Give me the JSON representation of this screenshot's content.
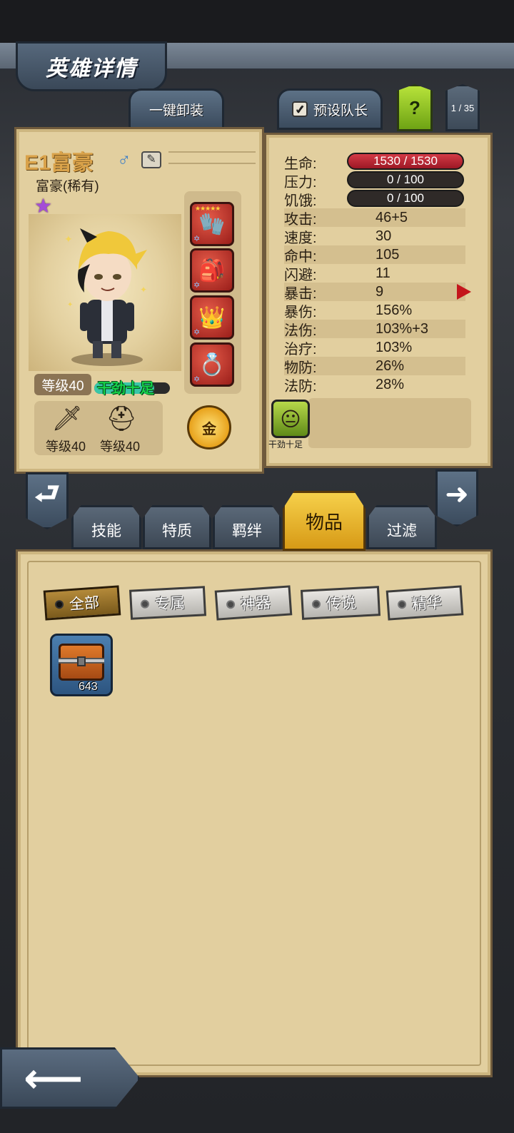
{
  "header": {
    "title": "英雄详情"
  },
  "actions": {
    "unequip_all": "一键卸装",
    "preset_leader": "预设队长",
    "preset_checked": "✓",
    "help": "?",
    "page_indicator": "1 / 35"
  },
  "hero": {
    "name": "E1富豪",
    "class": "富豪(稀有)",
    "level": "等级40",
    "trait": "干劲十足",
    "weapon_level": "等级40",
    "armor_level": "等级40",
    "gold_label": "金",
    "equipment_star_rating": "★★★★★"
  },
  "stats": {
    "hp": {
      "label": "生命:",
      "value": "1530 / 1530"
    },
    "stress": {
      "label": "压力:",
      "value": "0 / 100"
    },
    "hunger": {
      "label": "饥饿:",
      "value": "0 / 100"
    },
    "rows": [
      {
        "label": "攻击:",
        "value": "46+5"
      },
      {
        "label": "速度:",
        "value": "30"
      },
      {
        "label": "命中:",
        "value": "105"
      },
      {
        "label": "闪避:",
        "value": "11"
      },
      {
        "label": "暴击:",
        "value": "9"
      },
      {
        "label": "暴伤:",
        "value": "156%"
      },
      {
        "label": "法伤:",
        "value": "103%+3"
      },
      {
        "label": "治疗:",
        "value": "103%"
      },
      {
        "label": "物防:",
        "value": "26%"
      },
      {
        "label": "法防:",
        "value": "28%"
      }
    ],
    "trait_icon_label": "干劲十足"
  },
  "tabs": [
    "技能",
    "特质",
    "羁绊",
    "物品",
    "过滤"
  ],
  "active_tab": "物品",
  "filters": [
    "全部",
    "专属",
    "神器",
    "传说",
    "精华"
  ],
  "active_filter": "全部",
  "inventory": [
    {
      "name": "chest",
      "count": "643"
    }
  ],
  "colors": {
    "parchment": "#e2cf9f",
    "accent_gold": "#f6d04a",
    "hp_red": "#d43a46",
    "trait_green": "#16d24a",
    "help_green": "#b7e23a"
  }
}
